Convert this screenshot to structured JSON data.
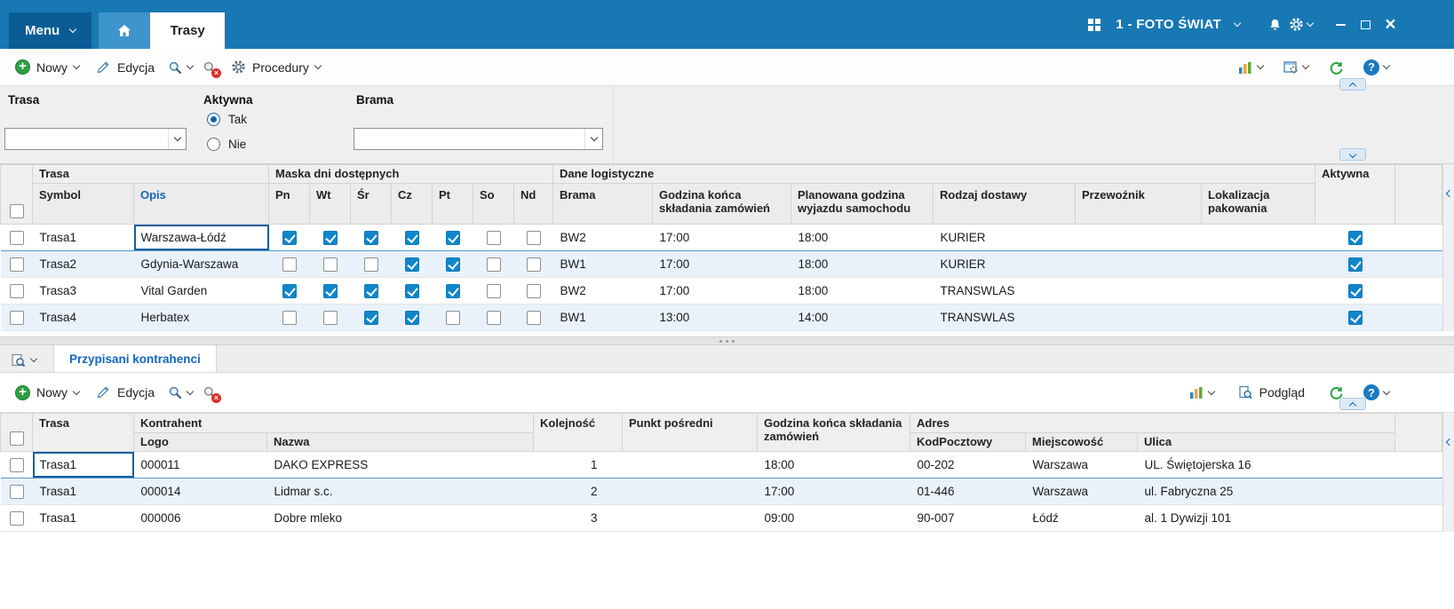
{
  "titlebar": {
    "menu": "Menu",
    "tab_trasy": "Trasy",
    "company": "1 - FOTO ŚWIAT"
  },
  "top_toolbar": {
    "nowy": "Nowy",
    "edycja": "Edycja",
    "procedury": "Procedury"
  },
  "filters": {
    "trasa_label": "Trasa",
    "trasa_value": "",
    "aktywna_label": "Aktywna",
    "option_tak": "Tak",
    "option_nie": "Nie",
    "tak_checked": true,
    "nie_checked": false,
    "brama_label": "Brama",
    "brama_value": ""
  },
  "routes_table": {
    "group_trasa": "Trasa",
    "group_maska": "Maska dni dostępnych",
    "group_dane": "Dane logistyczne",
    "col_aktywna": "Aktywna",
    "col_symbol": "Symbol",
    "col_opis": "Opis",
    "day_cols": [
      "Pn",
      "Wt",
      "Śr",
      "Cz",
      "Pt",
      "So",
      "Nd"
    ],
    "col_brama": "Brama",
    "col_godzina": "Godzina końca składania zamówień",
    "col_planowana": "Planowana godzina wyjazdu samochodu",
    "col_rodzaj": "Rodzaj dostawy",
    "col_przewoznik": "Przewoźnik",
    "col_lokalizacja": "Lokalizacja pakowania",
    "rows": [
      {
        "symbol": "Trasa1",
        "opis": "Warszawa-Łódź",
        "days": [
          true,
          true,
          true,
          true,
          true,
          false,
          false
        ],
        "brama": "BW2",
        "godzina": "17:00",
        "planowana": "18:00",
        "rodzaj": "KURIER",
        "przewoznik": "",
        "lokalizacja": "",
        "aktywna": true
      },
      {
        "symbol": "Trasa2",
        "opis": "Gdynia-Warszawa",
        "days": [
          false,
          false,
          false,
          true,
          true,
          false,
          false
        ],
        "brama": "BW1",
        "godzina": "17:00",
        "planowana": "18:00",
        "rodzaj": "KURIER",
        "przewoznik": "",
        "lokalizacja": "",
        "aktywna": true
      },
      {
        "symbol": "Trasa3",
        "opis": "Vital Garden",
        "days": [
          true,
          true,
          true,
          true,
          true,
          false,
          false
        ],
        "brama": "BW2",
        "godzina": "17:00",
        "planowana": "18:00",
        "rodzaj": "TRANSWLAS",
        "przewoznik": "",
        "lokalizacja": "",
        "aktywna": true
      },
      {
        "symbol": "Trasa4",
        "opis": "Herbatex",
        "days": [
          false,
          false,
          true,
          true,
          false,
          false,
          false
        ],
        "brama": "BW1",
        "godzina": "13:00",
        "planowana": "14:00",
        "rodzaj": "TRANSWLAS",
        "przewoznik": "",
        "lokalizacja": "",
        "aktywna": true
      }
    ]
  },
  "bottom_panel": {
    "tab": "Przypisani kontrahenci",
    "nowy": "Nowy",
    "edycja": "Edycja",
    "podglad": "Podgląd"
  },
  "contractors_table": {
    "group_trasa": "Trasa",
    "group_kontrahent": "Kontrahent",
    "col_logo": "Logo",
    "col_nazwa": "Nazwa",
    "col_kolejnosc": "Kolejność",
    "col_punkt": "Punkt pośredni",
    "col_godzina": "Godzina końca składania zamówień",
    "group_adres": "Adres",
    "col_kod": "KodPocztowy",
    "col_miejscowosc": "Miejscowość",
    "col_ulica": "Ulica",
    "rows": [
      {
        "trasa": "Trasa1",
        "logo": "000011",
        "nazwa": "DAKO EXPRESS",
        "kolejnosc": "1",
        "punkt": "",
        "godzina": "18:00",
        "kod": "00-202",
        "miejscowosc": "Warszawa",
        "ulica": "UL. Świętojerska 16"
      },
      {
        "trasa": "Trasa1",
        "logo": "000014",
        "nazwa": "Lidmar s.c.",
        "kolejnosc": "2",
        "punkt": "",
        "godzina": "17:00",
        "kod": "01-446",
        "miejscowosc": "Warszawa",
        "ulica": "ul. Fabryczna 25"
      },
      {
        "trasa": "Trasa1",
        "logo": "000006",
        "nazwa": "Dobre mleko",
        "kolejnosc": "3",
        "punkt": "",
        "godzina": "09:00",
        "kod": "90-007",
        "miejscowosc": "Łódź",
        "ulica": "al. 1 Dywizji 101"
      }
    ]
  },
  "icons": {
    "home": "house",
    "windows_grid": "four-squares",
    "bell": "notification-bell",
    "gear": "settings-gear",
    "plus": "green-plus-circle",
    "pencil": "edit-pencil",
    "magnifier": "search-lens",
    "delete": "search-lens-red-x",
    "chart": "bar-chart",
    "layout_settings": "window-with-gear",
    "refresh": "green-circular-arrow",
    "help": "blue-question-circle",
    "preview": "document-with-lens"
  },
  "colors": {
    "titlebar": "#1878b4",
    "menu_button": "#0b5c95",
    "home_tab": "#3d95cc",
    "accent": "#1565c0",
    "checkbox": "#1086ca",
    "row_alt": "#e9f2fa"
  }
}
